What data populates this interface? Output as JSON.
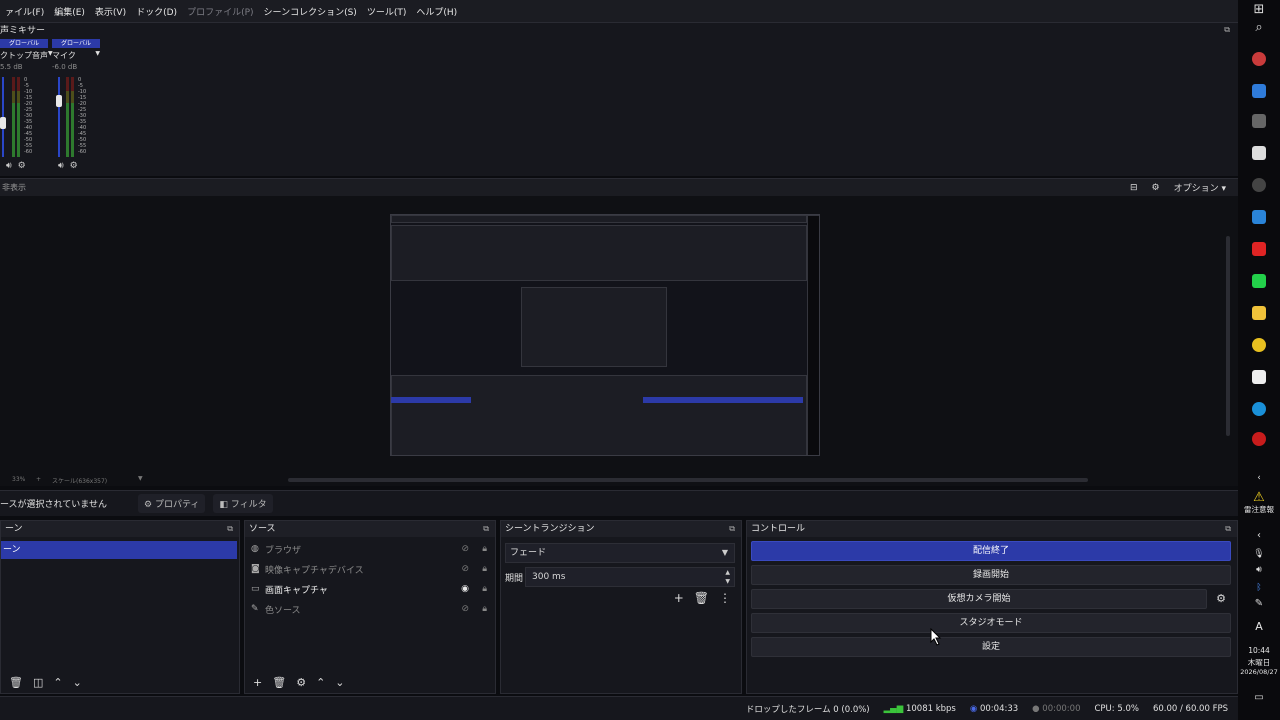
{
  "menu": [
    {
      "label": "ァイル(F)",
      "disabled": false
    },
    {
      "label": "編集(E)",
      "disabled": false
    },
    {
      "label": "表示(V)",
      "disabled": false
    },
    {
      "label": "ドック(D)",
      "disabled": false
    },
    {
      "label": "プロファイル(P)",
      "disabled": true
    },
    {
      "label": "シーンコレクション(S)",
      "disabled": false
    },
    {
      "label": "ツール(T)",
      "disabled": false
    },
    {
      "label": "ヘルプ(H)",
      "disabled": false
    }
  ],
  "mixer": {
    "title": "声ミキサー",
    "channels": [
      {
        "tag": "グローバル",
        "name": "クトップ音声",
        "db": "5.5 dB"
      },
      {
        "tag": "グローバル",
        "name": "マイク",
        "db": "-6.0 dB"
      }
    ],
    "ticks": [
      "0",
      "-5",
      "-10",
      "-15",
      "-20",
      "-25",
      "-30",
      "-35",
      "-40",
      "-45",
      "-50",
      "-55",
      "-60"
    ]
  },
  "preview": {
    "left_label": "非表示",
    "options_label": "オプション",
    "zoom_label": "33%",
    "scale_label": "スケール(636x357)"
  },
  "context": {
    "no_source": "ースが選択されていません",
    "properties": "プロパティ",
    "filters": "フィルタ"
  },
  "scenes": {
    "title": "ーン",
    "items": [
      "ーン"
    ]
  },
  "sources": {
    "title": "ソース",
    "items": [
      {
        "label": "ブラウザ",
        "icon": "globe-icon",
        "visible": false
      },
      {
        "label": "映像キャプチャデバイス",
        "icon": "camera-icon",
        "visible": false
      },
      {
        "label": "画面キャプチャ",
        "icon": "monitor-icon",
        "visible": true
      },
      {
        "label": "色ソース",
        "icon": "brush-icon",
        "visible": false
      }
    ]
  },
  "transitions": {
    "title": "シーントランジション",
    "selected": "フェード",
    "duration_label": "期間",
    "duration_value": "300 ms"
  },
  "controls": {
    "title": "コントロール",
    "stream": "配信終了",
    "record": "録画開始",
    "virtual_cam": "仮想カメラ開始",
    "studio_mode": "スタジオモード",
    "settings": "設定"
  },
  "status": {
    "dropped": "ドロップしたフレーム 0 (0.0%)",
    "bitrate": "10081 kbps",
    "stream_time": "00:04:33",
    "rec_time": "00:00:00",
    "cpu": "CPU: 5.0%",
    "fps": "60.00 / 60.00 FPS"
  },
  "taskbar": {
    "alert": "雷注意報",
    "ime": "A",
    "time": "10:44",
    "day": "木曜日",
    "date": "2026/08/27"
  }
}
